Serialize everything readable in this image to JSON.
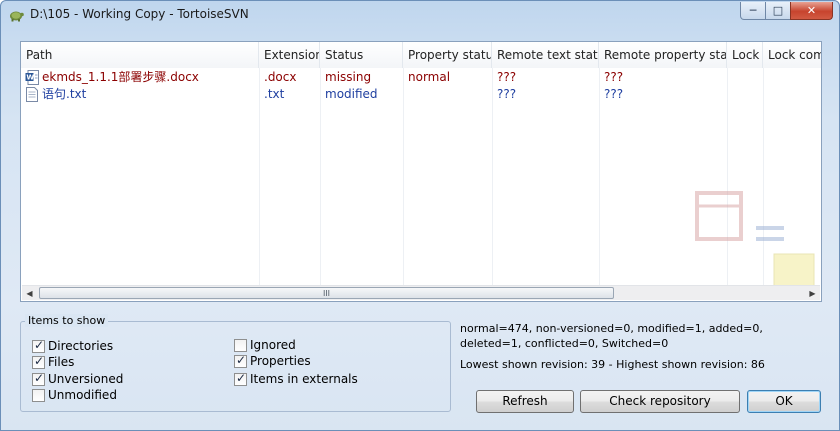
{
  "window": {
    "title": "D:\\105 - Working Copy - TortoiseSVN",
    "minimize_glyph": "─",
    "maximize_glyph": "□",
    "close_glyph": "✕"
  },
  "list": {
    "columns": [
      "Path",
      "Extension",
      "Status",
      "Property status",
      "Remote text status",
      "Remote property status",
      "Lock",
      "Lock comm"
    ],
    "rows": [
      {
        "icon": "word-document-icon",
        "path": "ekmds_1.1.1部署步骤.docx",
        "extension": ".docx",
        "status": "missing",
        "property_status": "normal",
        "remote_text_status": "???",
        "remote_property_status": "???",
        "color": "#8b0000"
      },
      {
        "icon": "text-file-icon",
        "path": "语句.txt",
        "extension": ".txt",
        "status": "modified",
        "property_status": "",
        "remote_text_status": "???",
        "remote_property_status": "???",
        "color": "#1f3fa0"
      }
    ],
    "scroll_thumb_grip": "III",
    "scroll_left_glyph": "◀",
    "scroll_right_glyph": "▶"
  },
  "items_to_show": {
    "title": "Items to show",
    "options": [
      {
        "label": "Directories",
        "checked": true
      },
      {
        "label": "Files",
        "checked": true
      },
      {
        "label": "Unversioned",
        "checked": true
      },
      {
        "label": "Unmodified",
        "checked": false
      },
      {
        "label": "Ignored",
        "checked": false
      },
      {
        "label": "Properties",
        "checked": true
      },
      {
        "label": "Items in externals",
        "checked": true
      }
    ]
  },
  "stats": {
    "summary": "normal=474, non-versioned=0, modified=1, added=0, deleted=1, conflicted=0, Switched=0",
    "revisions": "Lowest shown revision: 39 - Highest shown revision: 86"
  },
  "buttons": {
    "refresh": "Refresh",
    "check_repository": "Check repository",
    "ok": "OK"
  }
}
